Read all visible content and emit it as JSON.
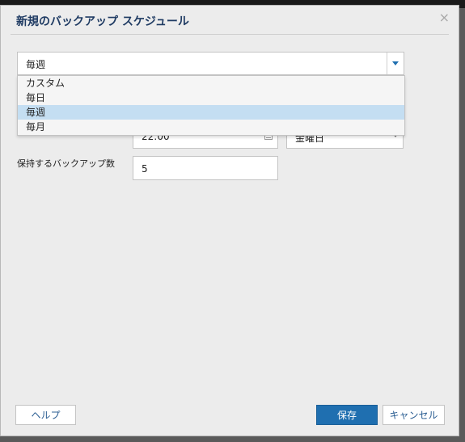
{
  "dialog": {
    "title": "新規のバックアップ スケジュール",
    "close_glyph": "×"
  },
  "schedule": {
    "frequency_value": "毎週",
    "options": [
      "カスタム",
      "毎日",
      "毎週",
      "毎月"
    ],
    "selected_option": "毎週"
  },
  "time": {
    "value": "22:00"
  },
  "weekday": {
    "value": "金曜日"
  },
  "retention": {
    "label": "保持するバックアップ数",
    "value": "5"
  },
  "footer": {
    "help_label": "ヘルプ",
    "save_label": "保存",
    "cancel_label": "キャンセル"
  },
  "colors": {
    "accent": "#1f6fb0",
    "title": "#1f3b63",
    "selected_option_bg": "#c4def2"
  },
  "icons": [
    "close-icon",
    "chevron-down-icon",
    "calendar-icon"
  ]
}
